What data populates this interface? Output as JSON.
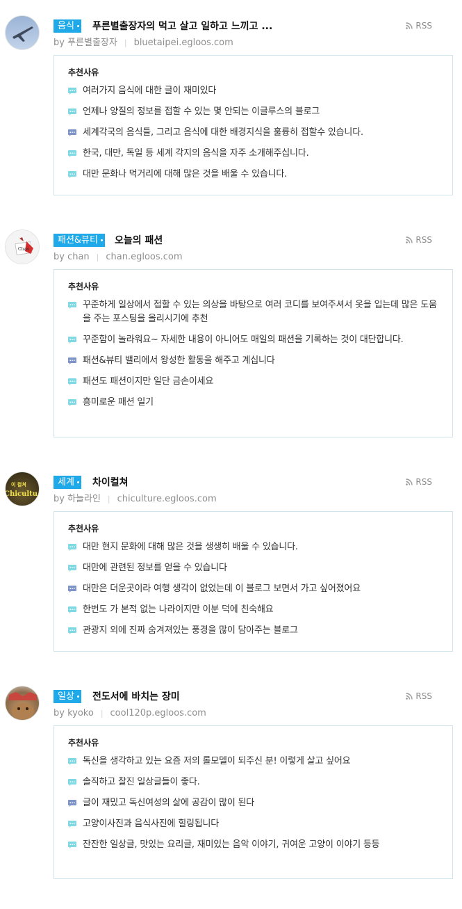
{
  "rss_label": "RSS",
  "reason_title": "추천사유",
  "entries": [
    {
      "category": "음식",
      "title": "푸른별출장자의 먹고 살고 일하고 느끼고 ...",
      "author": "by 푸른별출장자",
      "url": "bluetaipei.egloos.com",
      "reasons": [
        "여러가지 음식에 대한 글이 재미있다",
        "언제나 양질의 정보를 접할 수 있는 몇 안되는 이글루스의 블로그",
        "세계각국의 음식들, 그리고 음식에 대한 배경지식을 훌륭히 접할수 있습니다.",
        "한국, 대만, 독일 등 세계 각지의 음식을 자주 소개해주십니다.",
        "대만 문화나 먹거리에 대해 많은 것을 배울 수 있습니다."
      ]
    },
    {
      "category": "패션&뷰티",
      "title": "오늘의 패션",
      "author": "by chan",
      "url": "chan.egloos.com",
      "reasons": [
        "꾸준하게 일상에서 접할 수 있는 의상을 바탕으로 여러 코디를 보여주셔서 옷을 입는데 많은 도움을 주는 포스팅을 올리시기에 추천",
        "꾸준함이 놀라워요~ 자세한 내용이 아니어도 매일의 패션을 기록하는 것이 대단합니다.",
        "패션&뷰티 밸리에서 왕성한 활동을 해주고 계십니다",
        "패션도 패션이지만 일단 금손이세요",
        "흥미로운 패션 일기"
      ]
    },
    {
      "category": "세계",
      "title": "차이컬쳐",
      "author": "by 하늘라인",
      "url": "chiculture.egloos.com",
      "reasons": [
        "대만 현지 문화에 대해 많은 것을 생생히 배울 수 있습니다.",
        "대만에 관련된 정보를 얻을 수 있습니다",
        "대만은 더운곳이라 여행 생각이 없었는데 이 블로그 보면서 가고 싶어졌어요",
        "한번도 가 본적 없는 나라이지만 이분 덕에 친숙해요",
        "관광지 외에 진짜 숨겨져있는 풍경을 많이 담아주는 블로그"
      ]
    },
    {
      "category": "일상",
      "title": "전도서에 바치는 장미",
      "author": "by kyoko",
      "url": "cool120p.egloos.com",
      "reasons": [
        "독신을 생각하고 있는 요즘 저의 롤모델이 되주신 분! 이렇게 살고 싶어요",
        "솔직하고 찰진 일상글들이 좋다.",
        "글이 재밌고 독신여성의 삶에 공감이 많이 된다",
        "고양이사진과 음식사진에 힐링됩니다",
        "잔잔한 일상글, 맛있는 요리글, 재미있는 음악 이야기, 귀여운 고양이 이야기 등등"
      ]
    }
  ],
  "avatar_text": {
    "chan": "Chan",
    "chiculture_top": "이 컬쳐",
    "chiculture_bottom": "Chicultu"
  },
  "colors": {
    "category_bg": "#1fa9e8",
    "icon_light": "#7fd8e2",
    "icon_dark": "#7e93c7",
    "box_border": "#cfe3eb"
  }
}
